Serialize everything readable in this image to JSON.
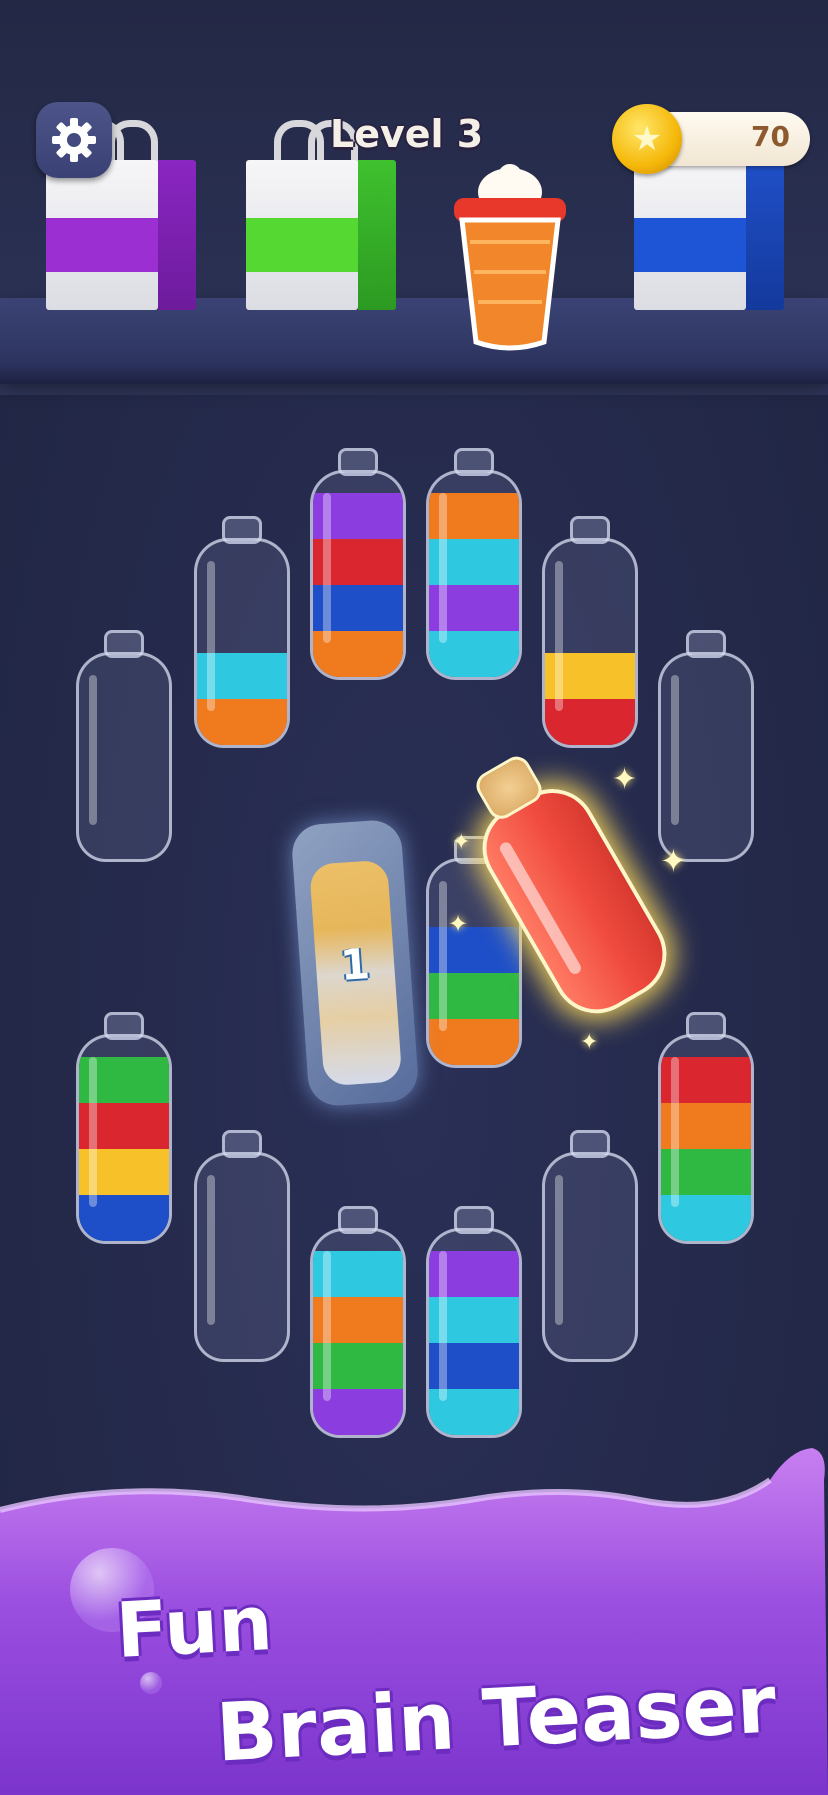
{
  "header": {
    "level_label": "Level 3",
    "coins": "70",
    "settings_icon": "gear-icon",
    "coin_icon": "star-coin-icon"
  },
  "bags": [
    {
      "color": "#9b2fd2"
    },
    {
      "color": "#55d832"
    },
    {
      "color": "#1e55d6"
    }
  ],
  "bottles": [
    {
      "segments": []
    },
    {
      "segments": [
        "#f07a1e",
        "#2ec9e0"
      ]
    },
    {
      "segments": [
        "#f07a1e",
        "#1e4fc8",
        "#d9262f",
        "#8c3de0"
      ]
    },
    {
      "segments": [
        "#2ec9e0",
        "#8c3de0",
        "#2ec9e0",
        "#f07a1e"
      ]
    },
    {
      "segments": [
        "#d9262f",
        "#f7c12a"
      ]
    },
    {
      "segments": []
    },
    {
      "segments": [
        "#f07a1e",
        "#2fb842",
        "#1e4fc8"
      ]
    },
    {
      "segments": [
        "#1e4fc8",
        "#f7c12a",
        "#d9262f",
        "#2fb842"
      ]
    },
    {
      "segments": []
    },
    {
      "segments": [
        "#8c3de0",
        "#2fb842",
        "#f07a1e",
        "#2ec9e0"
      ]
    },
    {
      "segments": [
        "#2ec9e0",
        "#1e4fc8",
        "#2ec9e0",
        "#8c3de0"
      ]
    },
    {
      "segments": []
    },
    {
      "segments": [
        "#2ec9e0",
        "#2fb842",
        "#f07a1e",
        "#d9262f"
      ]
    }
  ],
  "frozen_bottle": {
    "count": "1"
  },
  "banner": {
    "line1": "Fun",
    "line2": "Brain Teaser"
  }
}
